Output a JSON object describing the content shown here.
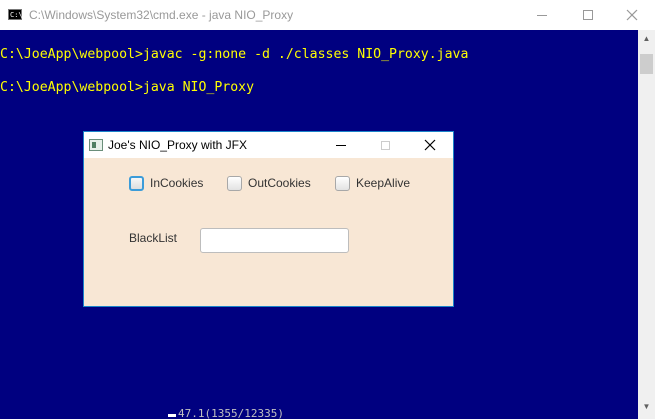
{
  "cmd_window": {
    "title": "C:\\Windows\\System32\\cmd.exe - java  NIO_Proxy",
    "icon_label": "C:\\",
    "buttons": {
      "minimize": "minimize",
      "maximize": "maximize",
      "close": "close"
    }
  },
  "console": {
    "lines": [
      "C:\\JoeApp\\webpool>javac -g:none -d ./classes NIO_Proxy.java",
      "C:\\JoeApp\\webpool>java NIO_Proxy"
    ],
    "bottom_fragment": "47.1(1355/12335)",
    "colors": {
      "background": "#000080",
      "text": "#ffff00"
    }
  },
  "dialog": {
    "title": "Joe's NIO_Proxy with JFX",
    "checkboxes": [
      {
        "label": "InCookies",
        "checked": false,
        "focused": true
      },
      {
        "label": "OutCookies",
        "checked": false,
        "focused": false
      },
      {
        "label": "KeepAlive",
        "checked": false,
        "focused": false
      }
    ],
    "blacklist": {
      "label": "BlackList",
      "value": "",
      "placeholder": ""
    },
    "colors": {
      "background": "#f8e7d5",
      "border": "#1b84c9"
    }
  }
}
